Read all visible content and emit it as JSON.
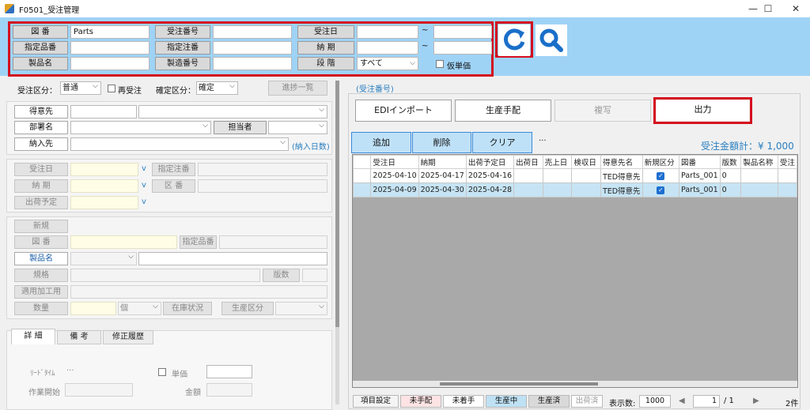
{
  "window": {
    "title": "F0501_受注管理",
    "minimize": "—",
    "maximize": "☐",
    "close": "✕"
  },
  "search": {
    "zuban_label": "図 番",
    "zuban_value": "Parts",
    "juchu_no_label": "受注番号",
    "juchu_date_label": "受注日",
    "shitei_hinban_label": "指定品番",
    "shitei_chuban_label": "指定注番",
    "nouki_label": "納 期",
    "seihin_label": "製品名",
    "seizo_no_label": "製造番号",
    "dankai_label": "段 階",
    "dankai_value": "すべて",
    "kari_tanka_label": "仮単価",
    "tilde": "~"
  },
  "form": {
    "juchu_kubun_label": "受注区分：",
    "juchu_kubun_value": "普通",
    "sai_juchu_label": "再受注",
    "kakutei_kubun_label": "確定区分：",
    "kakutei_kubun_value": "確定",
    "shinchoku_button": "進捗一覧",
    "tokuisaki": "得意先",
    "busho": "部署名",
    "tantou": "担当者",
    "nyunyu": "納入先",
    "nyunyu_link": "(納入日数)",
    "juchu_date": "受注日",
    "nouki": "納 期",
    "shukka_yotei": "出荷予定",
    "shitei_chuban": "指定注番",
    "kuban": "区 番",
    "v": "v",
    "shinki": "新規",
    "zuban": "図 番",
    "shitei_hinban": "指定品番",
    "seihin": "製品名",
    "kikaku": "規格",
    "hansu": "版数",
    "tekiyou": "適用加工用",
    "suryo": "数量",
    "ko": "個",
    "zaiko": "在庫状況",
    "seisan_kubun": "生産区分"
  },
  "tabs": {
    "shousai": "詳 細",
    "bikou": "備 考",
    "shusei": "修正履歴"
  },
  "detail": {
    "lead_time": "ﾘｰﾄﾞﾀｲﾑ",
    "lead_dots": "···",
    "tanka": "単価",
    "sagyo_kaishi": "作業開始",
    "kingaku": "金額"
  },
  "right": {
    "juchu_no_header": "(受注番号)",
    "edi_import": "EDIインポート",
    "seisan_tehai": "生産手配",
    "fukusha": "複写",
    "shutsuryoku": "出力",
    "tsuika": "追加",
    "sakujo": "削除",
    "clear": "クリア",
    "more": "···",
    "total_label": "受注金額計：¥ 1,000"
  },
  "grid": {
    "columns": [
      "受注日",
      "納期",
      "出荷予定日",
      "出荷日",
      "売上日",
      "検収日",
      "得意先名",
      "新規区分",
      "図番",
      "版数",
      "製品名称",
      "受注"
    ],
    "rows": [
      [
        "2025-04-10",
        "2025-04-17",
        "2025-04-16",
        "",
        "",
        "",
        "TED得意先",
        "✓",
        "Parts_001",
        "0",
        "",
        ""
      ],
      [
        "2025-04-09",
        "2025-04-30",
        "2025-04-28",
        "",
        "",
        "",
        "TED得意先",
        "✓",
        "Parts_001",
        "0",
        "",
        ""
      ]
    ]
  },
  "statusbar": {
    "koumoku": "項目設定",
    "mitehai": "未手配",
    "michakushu": "未着手",
    "seisanchu": "生産中",
    "seisanzumi": "生産済",
    "shukkazumi": "出荷済",
    "hyoji_label": "表示数:",
    "hyoji_value": "1000",
    "prev": "◀",
    "page": "1",
    "page_total": "/ 1",
    "next": "▶",
    "count": "2件"
  },
  "colors": {
    "panel_blue": "#9fd3f6",
    "highlight_red": "#d40f1e",
    "refresh_blue": "#1a6fc9",
    "total_text": "#2a7fc0"
  }
}
